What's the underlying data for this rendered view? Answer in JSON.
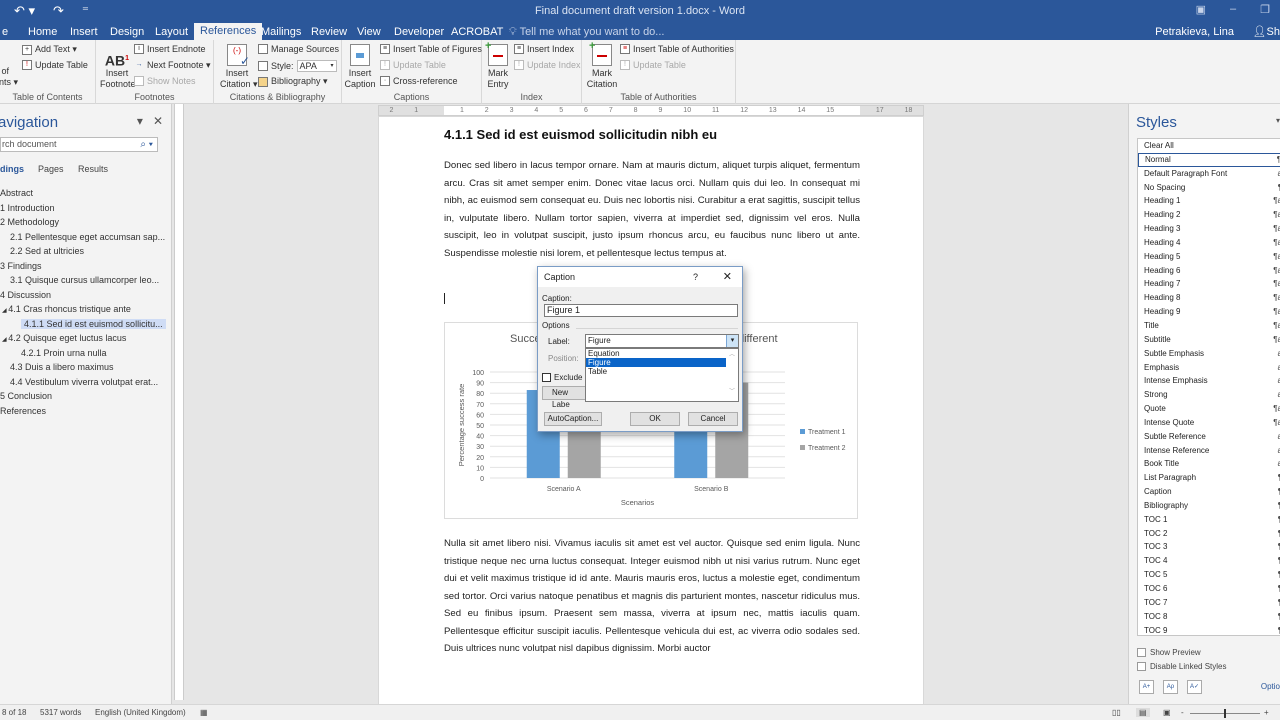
{
  "window": {
    "title": "Final document draft version 1.docx - Word",
    "user": "Petrakieva, Lina",
    "share_label": "Sh"
  },
  "qat": {
    "undo": "↶ ▾",
    "redo": "↷",
    "customize": "⁼"
  },
  "tabs": [
    {
      "label": "Home"
    },
    {
      "label": "Insert"
    },
    {
      "label": "Design"
    },
    {
      "label": "Layout"
    },
    {
      "label": "References",
      "active": true
    },
    {
      "label": "Mailings"
    },
    {
      "label": "Review"
    },
    {
      "label": "View"
    },
    {
      "label": "Developer"
    },
    {
      "label": "ACROBAT"
    }
  ],
  "tell_me": "Tell me what you want to do...",
  "ribbon": {
    "toc": {
      "label": "Table of Contents",
      "big": "e of\nents ▾",
      "add_text": "Add Text ▾",
      "update_table": "Update Table"
    },
    "footnotes": {
      "label": "Footnotes",
      "insert_footnote": "Insert\nFootnote",
      "insert_endnote": "Insert Endnote",
      "next_footnote": "Next Footnote ▾",
      "show_notes": "Show Notes"
    },
    "citations": {
      "label": "Citations & Bibliography",
      "insert_citation": "Insert\nCitation ▾",
      "manage_sources": "Manage Sources",
      "style_label": "Style:",
      "style_value": "APA",
      "bibliography": "Bibliography ▾"
    },
    "captions": {
      "label": "Captions",
      "insert_caption": "Insert\nCaption",
      "insert_tof": "Insert Table of Figures",
      "update_table": "Update Table",
      "cross_reference": "Cross-reference"
    },
    "index": {
      "label": "Index",
      "mark_entry": "Mark\nEntry",
      "insert_index": "Insert Index",
      "update_index": "Update Index"
    },
    "toa": {
      "label": "Table of Authorities",
      "mark_citation": "Mark\nCitation",
      "insert_toa": "Insert Table of Authorities",
      "update_table": "Update Table"
    }
  },
  "navigation": {
    "title": "avigation",
    "search_placeholder": "rch document",
    "tabs": [
      "dings",
      "Pages",
      "Results"
    ],
    "items": [
      {
        "label": "Abstract",
        "level": 0
      },
      {
        "label": "1 Introduction",
        "level": 0
      },
      {
        "label": "2 Methodology",
        "level": 0
      },
      {
        "label": "2.1 Pellentesque eget accumsan sap...",
        "level": 1
      },
      {
        "label": "2.2 Sed at ultricies",
        "level": 1
      },
      {
        "label": "3 Findings",
        "level": 0
      },
      {
        "label": "3.1 Quisque cursus ullamcorper leo...",
        "level": 1
      },
      {
        "label": "4 Discussion",
        "level": 0
      },
      {
        "label": "4.1 Cras rhoncus tristique ante",
        "level": 1,
        "expanded": true
      },
      {
        "label": "4.1.1 Sed id est euismod sollicitu...",
        "level": 2,
        "selected": true
      },
      {
        "label": "4.2 Quisque eget luctus lacus",
        "level": 1,
        "expanded": true
      },
      {
        "label": "4.2.1 Proin urna nulla",
        "level": 2
      },
      {
        "label": "4.3 Duis a libero maximus",
        "level": 1
      },
      {
        "label": "4.4 Vestibulum viverra volutpat erat...",
        "level": 1
      },
      {
        "label": "5 Conclusion",
        "level": 0
      },
      {
        "label": "References",
        "level": 0
      }
    ]
  },
  "ruler": {
    "ticks": [
      "2",
      "1",
      "",
      "1",
      "2",
      "3",
      "4",
      "5",
      "6",
      "7",
      "8",
      "9",
      "10",
      "11",
      "12",
      "13",
      "14",
      "15",
      "",
      "17",
      "18"
    ]
  },
  "document": {
    "heading": "4.1.1 Sed id est euismod sollicitudin nibh eu",
    "para1": "Donec sed libero in lacus tempor ornare. Nam at mauris dictum, aliquet turpis aliquet, fermentum arcu. Cras sit amet semper enim. Donec vitae lacus orci. Nullam quis dui leo. In consequat mi nibh, ac euismod sem consequat eu. Duis nec lobortis nisi. Curabitur a erat sagittis, suscipit tellus in, vulputate libero. Nullam tortor sapien, viverra at imperdiet sed, dignissim vel eros. Nulla suscipit, leo in volutpat suscipit, justo ipsum rhoncus arcu, eu faucibus nunc libero ut ante. Suspendisse molestie nisi lorem, et pellentesque lectus tempus at.",
    "para2": "Nulla sit amet libero nisi. Vivamus iaculis sit amet est vel auctor. Quisque sed enim ligula. Nunc tristique neque nec urna luctus consequat. Integer euismod nibh ut nisi varius rutrum. Nunc eget dui et velit maximus tristique id id ante. Mauris mauris eros, luctus a molestie eget, condimentum sed tortor. Orci varius natoque penatibus et magnis dis parturient montes, nascetur ridiculus mus. Sed eu finibus ipsum. Praesent sem massa, viverra at ipsum nec, mattis iaculis quam. Pellentesque efficitur suscipit iaculis. Pellentesque vehicula dui est, ac viverra odio sodales sed. Duis ultrices nunc volutpat nisl dapibus dignissim. Morbi auctor"
  },
  "chart_data": {
    "type": "bar",
    "title_left": "Succe",
    "title_right": "different",
    "categories": [
      "Scenario A",
      "Scenario B"
    ],
    "series": [
      {
        "name": "Treatment 1",
        "color": "#5b9bd5",
        "values": [
          83,
          85
        ]
      },
      {
        "name": "Treatment 2",
        "color": "#a5a5a5",
        "values": [
          88,
          90
        ]
      }
    ],
    "xlabel": "Scenarios",
    "ylabel": "Percentage success rate",
    "ylim": [
      0,
      100
    ],
    "yticks": [
      "0",
      "10",
      "20",
      "30",
      "40",
      "50",
      "60",
      "70",
      "80",
      "90",
      "100"
    ],
    "grid": true,
    "legend": "right"
  },
  "dialog": {
    "title": "Caption",
    "help": "?",
    "close": "✕",
    "caption_label": "Caption:",
    "caption_value": "Figure 1",
    "options_label": "Options",
    "label_label": "Label:",
    "label_value": "Figure",
    "position_label": "Position:",
    "label_options": [
      "Equation",
      "Figure",
      "Table"
    ],
    "selected_option": "Figure",
    "exclude_label": "Exclude l",
    "new_label": "New Labe",
    "autocaption": "AutoCaption...",
    "ok": "OK",
    "cancel": "Cancel"
  },
  "styles": {
    "title": "Styles",
    "items": [
      {
        "name": "Clear All",
        "mark": ""
      },
      {
        "name": "Normal",
        "mark": "¶",
        "selected": true
      },
      {
        "name": "Default Paragraph Font",
        "mark": "a"
      },
      {
        "name": "No Spacing",
        "mark": "¶"
      },
      {
        "name": "Heading 1",
        "mark": "¶a"
      },
      {
        "name": "Heading 2",
        "mark": "¶a"
      },
      {
        "name": "Heading 3",
        "mark": "¶a"
      },
      {
        "name": "Heading 4",
        "mark": "¶a"
      },
      {
        "name": "Heading 5",
        "mark": "¶a"
      },
      {
        "name": "Heading 6",
        "mark": "¶a"
      },
      {
        "name": "Heading 7",
        "mark": "¶a"
      },
      {
        "name": "Heading 8",
        "mark": "¶a"
      },
      {
        "name": "Heading 9",
        "mark": "¶a"
      },
      {
        "name": "Title",
        "mark": "¶a"
      },
      {
        "name": "Subtitle",
        "mark": "¶a"
      },
      {
        "name": "Subtle Emphasis",
        "mark": "a"
      },
      {
        "name": "Emphasis",
        "mark": "a"
      },
      {
        "name": "Intense Emphasis",
        "mark": "a"
      },
      {
        "name": "Strong",
        "mark": "a"
      },
      {
        "name": "Quote",
        "mark": "¶a"
      },
      {
        "name": "Intense Quote",
        "mark": "¶a"
      },
      {
        "name": "Subtle Reference",
        "mark": "a"
      },
      {
        "name": "Intense Reference",
        "mark": "a"
      },
      {
        "name": "Book Title",
        "mark": "a"
      },
      {
        "name": "List Paragraph",
        "mark": "¶"
      },
      {
        "name": "Caption",
        "mark": "¶"
      },
      {
        "name": "Bibliography",
        "mark": "¶"
      },
      {
        "name": "TOC 1",
        "mark": "¶"
      },
      {
        "name": "TOC 2",
        "mark": "¶"
      },
      {
        "name": "TOC 3",
        "mark": "¶"
      },
      {
        "name": "TOC 4",
        "mark": "¶"
      },
      {
        "name": "TOC 5",
        "mark": "¶"
      },
      {
        "name": "TOC 6",
        "mark": "¶"
      },
      {
        "name": "TOC 7",
        "mark": "¶"
      },
      {
        "name": "TOC 8",
        "mark": "¶"
      },
      {
        "name": "TOC 9",
        "mark": "¶"
      }
    ],
    "show_preview": "Show Preview",
    "disable_linked": "Disable Linked Styles",
    "options": "Optio"
  },
  "status": {
    "page": "8 of 18",
    "words": "5317 words",
    "language": "English (United Kingdom)",
    "zoom_minus": "-",
    "zoom_plus": "+"
  }
}
